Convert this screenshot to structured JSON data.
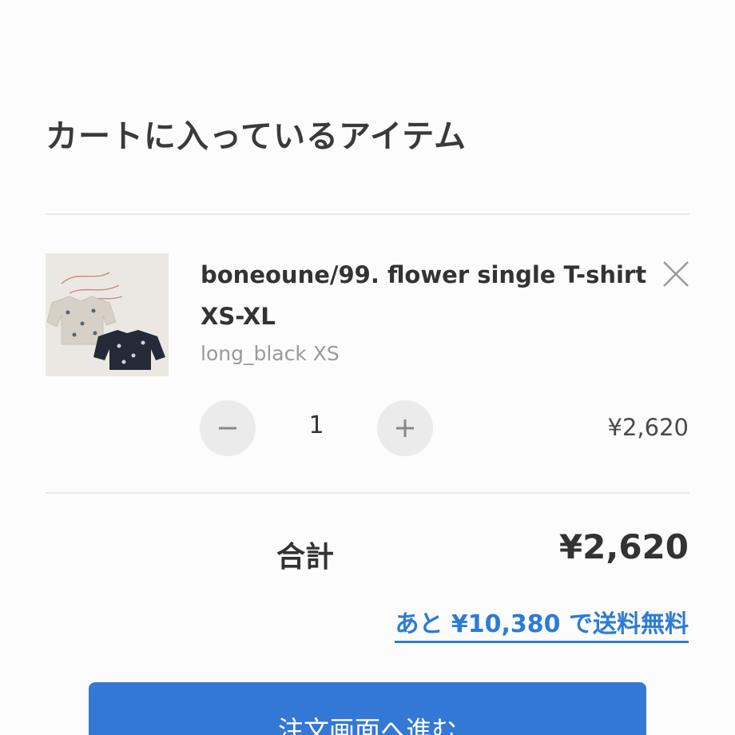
{
  "cart": {
    "title": "カートに入っているアイテム",
    "item": {
      "name_line1": "boneoune/99. flower single T-shirt",
      "name_line2": "XS-XL",
      "variant": "long_black XS",
      "quantity": "1",
      "price": "¥2,620",
      "image_icon": "product-thumbnail",
      "remove_icon": "close-icon",
      "decrement_icon": "minus-icon",
      "increment_icon": "plus-icon"
    },
    "total_label": "合計",
    "total_value": "¥2,620",
    "free_shipping_notice": "あと ¥10,380 で送料無料",
    "checkout_label": "注文画面へ進む"
  },
  "colors": {
    "accent": "#3478d6",
    "link": "#2d7bd6",
    "button_bg": "#ebebeb",
    "divider": "#e9e9e9"
  }
}
